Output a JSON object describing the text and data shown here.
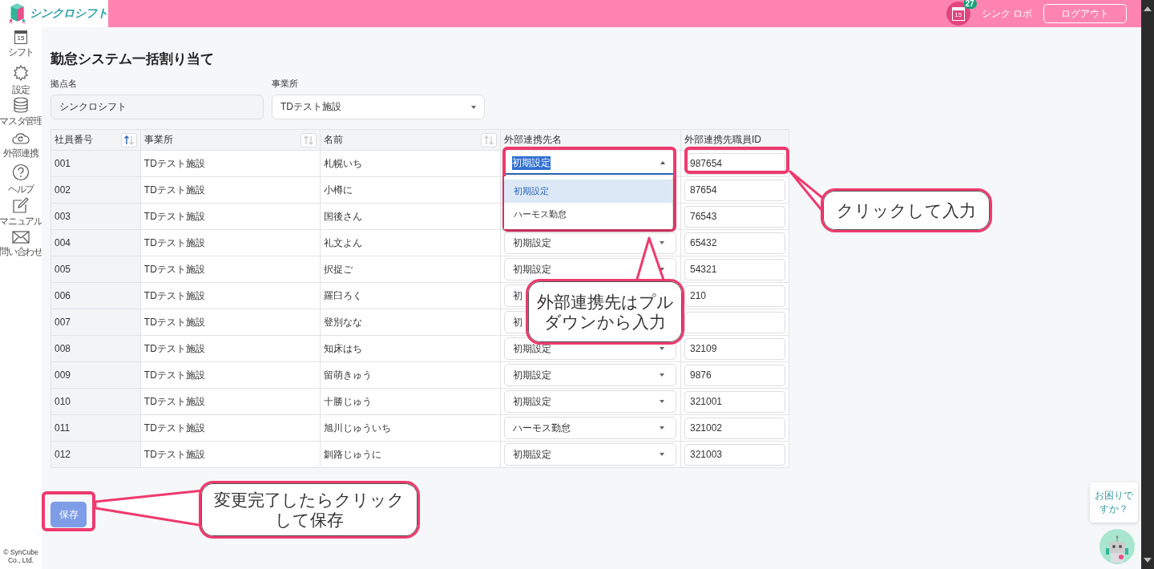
{
  "header": {
    "logo_text": "シンクロシフト",
    "calendar_day": "15",
    "badge": "27",
    "user_name": "シンク ロボ",
    "logout_button": "ログアウト"
  },
  "sidebar": {
    "items": [
      {
        "kind": "calendar",
        "label": "シフト",
        "calendar_day": "15"
      },
      {
        "kind": "gear",
        "label": "設定"
      },
      {
        "kind": "database",
        "label": "マスタ管理"
      },
      {
        "kind": "cloud",
        "label": "外部連携"
      },
      {
        "kind": "help",
        "label": "ヘルプ"
      },
      {
        "kind": "edit",
        "label": "マニュアル"
      },
      {
        "kind": "mail",
        "label": "問い合わせ"
      }
    ],
    "copyright": "© SynCube Co., Ltd."
  },
  "page": {
    "title": "勤怠システム一括割り当て",
    "base_label": "拠点名",
    "base_value": "シンクロシフト",
    "office_label": "事業所",
    "office_value": "TDテスト施設"
  },
  "table": {
    "columns": [
      {
        "label": "社員番号",
        "sorted": true
      },
      {
        "label": "事業所",
        "sorted": false
      },
      {
        "label": "名前",
        "sorted": false
      },
      {
        "label": "外部連携先名"
      },
      {
        "label": "外部連携先職員ID"
      }
    ],
    "rows": [
      {
        "number": "001",
        "office": "TDテスト施設",
        "name": "札幌いち",
        "system": "初期設定",
        "open": true,
        "options": [
          {
            "label": "初期設定",
            "selected": true
          },
          {
            "label": "ハーモス勤怠",
            "selected": false
          }
        ],
        "staff_id": "987654"
      },
      {
        "number": "002",
        "office": "TDテスト施設",
        "name": "小樽に",
        "open": false,
        "staff_id": "87654"
      },
      {
        "number": "003",
        "office": "TDテスト施設",
        "name": "国後さん",
        "open": false,
        "staff_id": "76543"
      },
      {
        "number": "004",
        "office": "TDテスト施設",
        "name": "礼文よん",
        "system": "初期設定",
        "open": false,
        "staff_id": "65432"
      },
      {
        "number": "005",
        "office": "TDテスト施設",
        "name": "択捉ご",
        "system": "初期設定",
        "open": false,
        "staff_id": "54321"
      },
      {
        "number": "006",
        "office": "TDテスト施設",
        "name": "羅臼ろく",
        "system": "初",
        "open": false,
        "staff_id": "210"
      },
      {
        "number": "007",
        "office": "TDテスト施設",
        "name": "登別なな",
        "system": "初",
        "open": false
      },
      {
        "number": "008",
        "office": "TDテスト施設",
        "name": "知床はち",
        "system": "初期設定",
        "open": false,
        "staff_id": "32109"
      },
      {
        "number": "009",
        "office": "TDテスト施設",
        "name": "留萌きゅう",
        "system": "初期設定",
        "open": false,
        "staff_id": "9876"
      },
      {
        "number": "010",
        "office": "TDテスト施設",
        "name": "十勝じゅう",
        "system": "初期設定",
        "open": false,
        "staff_id": "321001"
      },
      {
        "number": "011",
        "office": "TDテスト施設",
        "name": "旭川じゅういち",
        "system": "ハーモス勤怠",
        "open": false,
        "staff_id": "321002"
      },
      {
        "number": "012",
        "office": "TDテスト施設",
        "name": "釧路じゅうに",
        "system": "初期設定",
        "open": false,
        "staff_id": "321003"
      }
    ]
  },
  "save_button": "保存",
  "help_widget": {
    "text": "お困りですか？"
  },
  "callouts": [
    {
      "kind": "id",
      "text": "クリックして入力"
    },
    {
      "kind": "dropdown",
      "text": "外部連携先はプルダウンから入力"
    },
    {
      "kind": "save",
      "text": "変更完了したらクリックして保存"
    }
  ]
}
